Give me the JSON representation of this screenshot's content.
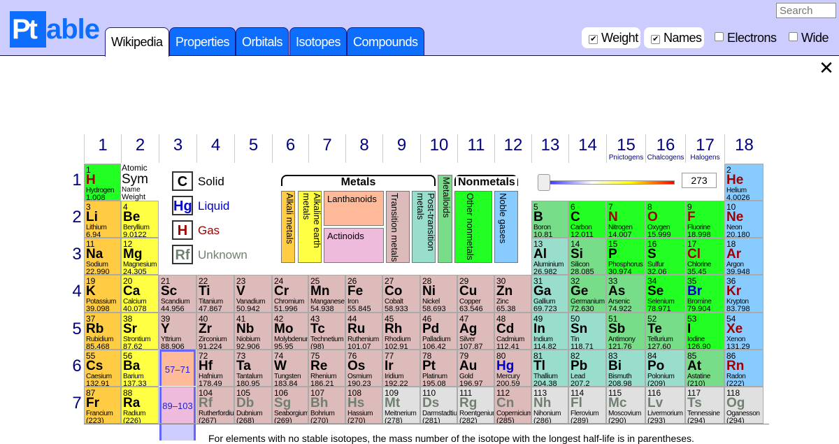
{
  "app": {
    "logo_pt": "Pt",
    "logo_able": "able",
    "search_placeholder": "Search",
    "close_glyph": "✕"
  },
  "tabs": [
    {
      "label": "Wikipedia",
      "active": true
    },
    {
      "label": "Properties",
      "active": false
    },
    {
      "label": "Orbitals",
      "active": false
    },
    {
      "label": "Isotopes",
      "active": false
    },
    {
      "label": "Compounds",
      "active": false
    }
  ],
  "options": [
    {
      "label": "Weight",
      "checked": true
    },
    {
      "label": "Names",
      "checked": true
    },
    {
      "label": "Electrons",
      "checked": false
    },
    {
      "label": "Wide",
      "checked": false
    }
  ],
  "groups": [
    "1",
    "2",
    "3",
    "4",
    "5",
    "6",
    "7",
    "8",
    "9",
    "10",
    "11",
    "12",
    "13",
    "14",
    "15",
    "16",
    "17",
    "18"
  ],
  "group_subtitles": {
    "15": "Pnictogens",
    "16": "Chalcogens",
    "17": "Halogens"
  },
  "periods": [
    "1",
    "2",
    "3",
    "4",
    "5",
    "6",
    "7"
  ],
  "key": {
    "number": "1",
    "sym": "Sym",
    "line1": "Atomic",
    "line3": "Name",
    "line4": "Weight"
  },
  "states": [
    {
      "sym": "C",
      "label": "Solid",
      "color": "#000000"
    },
    {
      "sym": "Hg",
      "label": "Liquid",
      "color": "#0000cc"
    },
    {
      "sym": "H",
      "label": "Gas",
      "color": "#a00000"
    },
    {
      "sym": "Rf",
      "label": "Unknown",
      "color": "#708070"
    }
  ],
  "categories_labels": {
    "metals": "Metals",
    "nonmetals": "Nonmetals"
  },
  "categories": [
    {
      "id": "alkali",
      "label": "Alkali metals",
      "color": "#ffcc44"
    },
    {
      "id": "alkaline",
      "label": "Alkaline earth metals",
      "color": "#ffff44"
    },
    {
      "id": "lanthanoid",
      "label": "Lanthanoids",
      "color": "#ffbb99"
    },
    {
      "id": "actinoid",
      "label": "Actinoids",
      "color": "#eebbdd"
    },
    {
      "id": "transition",
      "label": "Transition metals",
      "color": "#ddbbbb"
    },
    {
      "id": "post",
      "label": "Post-transition metals",
      "color": "#99ddcc"
    },
    {
      "id": "metalloid",
      "label": "Metalloids",
      "color": "#77dd88"
    },
    {
      "id": "nonmetal",
      "label": "Other nonmetals",
      "color": "#22ff22"
    },
    {
      "id": "noble",
      "label": "Noble gases",
      "color": "#88ccff"
    },
    {
      "id": "unknown",
      "label": "Unknown",
      "color": "#e0e0e0"
    }
  ],
  "temperature": "273",
  "series_labels": {
    "lanthanides": "57–71",
    "actinides": "89–103"
  },
  "footnote": "For elements with no stable isotopes, the mass number of the isotope with the longest half-life is in parentheses.",
  "elements": [
    [
      1,
      "H",
      "Hydrogen",
      "1.008",
      1,
      1,
      "nonmetal",
      "gas"
    ],
    [
      2,
      "He",
      "Helium",
      "4.0026",
      18,
      1,
      "noble",
      "gas"
    ],
    [
      3,
      "Li",
      "Lithium",
      "6.94",
      1,
      2,
      "alkali",
      "solid"
    ],
    [
      4,
      "Be",
      "Beryllium",
      "9.0122",
      2,
      2,
      "alkaline",
      "solid"
    ],
    [
      5,
      "B",
      "Boron",
      "10.81",
      13,
      2,
      "metalloid",
      "solid"
    ],
    [
      6,
      "C",
      "Carbon",
      "12.011",
      14,
      2,
      "nonmetal",
      "solid"
    ],
    [
      7,
      "N",
      "Nitrogen",
      "14.007",
      15,
      2,
      "nonmetal",
      "gas"
    ],
    [
      8,
      "O",
      "Oxygen",
      "15.999",
      16,
      2,
      "nonmetal",
      "gas"
    ],
    [
      9,
      "F",
      "Fluorine",
      "18.998",
      17,
      2,
      "nonmetal",
      "gas"
    ],
    [
      10,
      "Ne",
      "Neon",
      "20.180",
      18,
      2,
      "noble",
      "gas"
    ],
    [
      11,
      "Na",
      "Sodium",
      "22.990",
      1,
      3,
      "alkali",
      "solid"
    ],
    [
      12,
      "Mg",
      "Magnesium",
      "24.305",
      2,
      3,
      "alkaline",
      "solid"
    ],
    [
      13,
      "Al",
      "Aluminium",
      "26.982",
      13,
      3,
      "post",
      "solid"
    ],
    [
      14,
      "Si",
      "Silicon",
      "28.085",
      14,
      3,
      "metalloid",
      "solid"
    ],
    [
      15,
      "P",
      "Phosphorus",
      "30.974",
      15,
      3,
      "nonmetal",
      "solid"
    ],
    [
      16,
      "S",
      "Sulfur",
      "32.06",
      16,
      3,
      "nonmetal",
      "solid"
    ],
    [
      17,
      "Cl",
      "Chlorine",
      "35.45",
      17,
      3,
      "nonmetal",
      "gas"
    ],
    [
      18,
      "Ar",
      "Argon",
      "39.948",
      18,
      3,
      "noble",
      "gas"
    ],
    [
      19,
      "K",
      "Potassium",
      "39.098",
      1,
      4,
      "alkali",
      "solid"
    ],
    [
      20,
      "Ca",
      "Calcium",
      "40.078",
      2,
      4,
      "alkaline",
      "solid"
    ],
    [
      21,
      "Sc",
      "Scandium",
      "44.956",
      3,
      4,
      "transition",
      "solid"
    ],
    [
      22,
      "Ti",
      "Titanium",
      "47.867",
      4,
      4,
      "transition",
      "solid"
    ],
    [
      23,
      "V",
      "Vanadium",
      "50.942",
      5,
      4,
      "transition",
      "solid"
    ],
    [
      24,
      "Cr",
      "Chromium",
      "51.996",
      6,
      4,
      "transition",
      "solid"
    ],
    [
      25,
      "Mn",
      "Manganese",
      "54.938",
      7,
      4,
      "transition",
      "solid"
    ],
    [
      26,
      "Fe",
      "Iron",
      "55.845",
      8,
      4,
      "transition",
      "solid"
    ],
    [
      27,
      "Co",
      "Cobalt",
      "58.933",
      9,
      4,
      "transition",
      "solid"
    ],
    [
      28,
      "Ni",
      "Nickel",
      "58.693",
      10,
      4,
      "transition",
      "solid"
    ],
    [
      29,
      "Cu",
      "Copper",
      "63.546",
      11,
      4,
      "transition",
      "solid"
    ],
    [
      30,
      "Zn",
      "Zinc",
      "65.38",
      12,
      4,
      "transition",
      "solid"
    ],
    [
      31,
      "Ga",
      "Gallium",
      "69.723",
      13,
      4,
      "post",
      "solid"
    ],
    [
      32,
      "Ge",
      "Germanium",
      "72.630",
      14,
      4,
      "metalloid",
      "solid"
    ],
    [
      33,
      "As",
      "Arsenic",
      "74.922",
      15,
      4,
      "metalloid",
      "solid"
    ],
    [
      34,
      "Se",
      "Selenium",
      "78.971",
      16,
      4,
      "nonmetal",
      "solid"
    ],
    [
      35,
      "Br",
      "Bromine",
      "79.904",
      17,
      4,
      "nonmetal",
      "liquid"
    ],
    [
      36,
      "Kr",
      "Krypton",
      "83.798",
      18,
      4,
      "noble",
      "gas"
    ],
    [
      37,
      "Rb",
      "Rubidium",
      "85.468",
      1,
      5,
      "alkali",
      "solid"
    ],
    [
      38,
      "Sr",
      "Strontium",
      "87.62",
      2,
      5,
      "alkaline",
      "solid"
    ],
    [
      39,
      "Y",
      "Yttrium",
      "88.906",
      3,
      5,
      "transition",
      "solid"
    ],
    [
      40,
      "Zr",
      "Zirconium",
      "91.224",
      4,
      5,
      "transition",
      "solid"
    ],
    [
      41,
      "Nb",
      "Niobium",
      "92.906",
      5,
      5,
      "transition",
      "solid"
    ],
    [
      42,
      "Mo",
      "Molybdenum",
      "95.95",
      6,
      5,
      "transition",
      "solid"
    ],
    [
      43,
      "Tc",
      "Technetium",
      "(98)",
      7,
      5,
      "transition",
      "solid"
    ],
    [
      44,
      "Ru",
      "Ruthenium",
      "101.07",
      8,
      5,
      "transition",
      "solid"
    ],
    [
      45,
      "Rh",
      "Rhodium",
      "102.91",
      9,
      5,
      "transition",
      "solid"
    ],
    [
      46,
      "Pd",
      "Palladium",
      "106.42",
      10,
      5,
      "transition",
      "solid"
    ],
    [
      47,
      "Ag",
      "Silver",
      "107.87",
      11,
      5,
      "transition",
      "solid"
    ],
    [
      48,
      "Cd",
      "Cadmium",
      "112.41",
      12,
      5,
      "transition",
      "solid"
    ],
    [
      49,
      "In",
      "Indium",
      "114.82",
      13,
      5,
      "post",
      "solid"
    ],
    [
      50,
      "Sn",
      "Tin",
      "118.71",
      14,
      5,
      "post",
      "solid"
    ],
    [
      51,
      "Sb",
      "Antimony",
      "121.76",
      15,
      5,
      "metalloid",
      "solid"
    ],
    [
      52,
      "Te",
      "Tellurium",
      "127.60",
      16,
      5,
      "metalloid",
      "solid"
    ],
    [
      53,
      "I",
      "Iodine",
      "126.90",
      17,
      5,
      "nonmetal",
      "solid"
    ],
    [
      54,
      "Xe",
      "Xenon",
      "131.29",
      18,
      5,
      "noble",
      "gas"
    ],
    [
      55,
      "Cs",
      "Caesium",
      "132.91",
      1,
      6,
      "alkali",
      "solid"
    ],
    [
      56,
      "Ba",
      "Barium",
      "137.33",
      2,
      6,
      "alkaline",
      "solid"
    ],
    [
      72,
      "Hf",
      "Hafnium",
      "178.49",
      4,
      6,
      "transition",
      "solid"
    ],
    [
      73,
      "Ta",
      "Tantalum",
      "180.95",
      5,
      6,
      "transition",
      "solid"
    ],
    [
      74,
      "W",
      "Tungsten",
      "183.84",
      6,
      6,
      "transition",
      "solid"
    ],
    [
      75,
      "Re",
      "Rhenium",
      "186.21",
      7,
      6,
      "transition",
      "solid"
    ],
    [
      76,
      "Os",
      "Osmium",
      "190.23",
      8,
      6,
      "transition",
      "solid"
    ],
    [
      77,
      "Ir",
      "Iridium",
      "192.22",
      9,
      6,
      "transition",
      "solid"
    ],
    [
      78,
      "Pt",
      "Platinum",
      "195.08",
      10,
      6,
      "transition",
      "solid"
    ],
    [
      79,
      "Au",
      "Gold",
      "196.97",
      11,
      6,
      "transition",
      "solid"
    ],
    [
      80,
      "Hg",
      "Mercury",
      "200.59",
      12,
      6,
      "transition",
      "liquid"
    ],
    [
      81,
      "Tl",
      "Thallium",
      "204.38",
      13,
      6,
      "post",
      "solid"
    ],
    [
      82,
      "Pb",
      "Lead",
      "207.2",
      14,
      6,
      "post",
      "solid"
    ],
    [
      83,
      "Bi",
      "Bismuth",
      "208.98",
      15,
      6,
      "post",
      "solid"
    ],
    [
      84,
      "Po",
      "Polonium",
      "(209)",
      16,
      6,
      "post",
      "solid"
    ],
    [
      85,
      "At",
      "Astatine",
      "(210)",
      17,
      6,
      "metalloid",
      "solid"
    ],
    [
      86,
      "Rn",
      "Radon",
      "(222)",
      18,
      6,
      "noble",
      "gas"
    ],
    [
      87,
      "Fr",
      "Francium",
      "(223)",
      1,
      7,
      "alkali",
      "solid"
    ],
    [
      88,
      "Ra",
      "Radium",
      "(226)",
      2,
      7,
      "alkaline",
      "solid"
    ],
    [
      104,
      "Rf",
      "Rutherfordium",
      "(267)",
      4,
      7,
      "transition",
      "unknown"
    ],
    [
      105,
      "Db",
      "Dubnium",
      "(268)",
      5,
      7,
      "transition",
      "unknown"
    ],
    [
      106,
      "Sg",
      "Seaborgium",
      "(269)",
      6,
      7,
      "transition",
      "unknown"
    ],
    [
      107,
      "Bh",
      "Bohrium",
      "(270)",
      7,
      7,
      "transition",
      "unknown"
    ],
    [
      108,
      "Hs",
      "Hassium",
      "(270)",
      8,
      7,
      "transition",
      "unknown"
    ],
    [
      109,
      "Mt",
      "Meitnerium",
      "(278)",
      9,
      7,
      "unknown",
      "unknown"
    ],
    [
      110,
      "Ds",
      "Darmstadtium",
      "(281)",
      10,
      7,
      "unknown",
      "unknown"
    ],
    [
      111,
      "Rg",
      "Roentgenium",
      "(282)",
      11,
      7,
      "unknown",
      "unknown"
    ],
    [
      112,
      "Cn",
      "Copernicium",
      "(285)",
      12,
      7,
      "transition",
      "unknown"
    ],
    [
      113,
      "Nh",
      "Nihonium",
      "(286)",
      13,
      7,
      "unknown",
      "unknown"
    ],
    [
      114,
      "Fl",
      "Flerovium",
      "(289)",
      14,
      7,
      "unknown",
      "unknown"
    ],
    [
      115,
      "Mc",
      "Moscovium",
      "(290)",
      15,
      7,
      "unknown",
      "unknown"
    ],
    [
      116,
      "Lv",
      "Livermorium",
      "(293)",
      16,
      7,
      "unknown",
      "unknown"
    ],
    [
      117,
      "Ts",
      "Tennessine",
      "(294)",
      17,
      7,
      "unknown",
      "unknown"
    ],
    [
      118,
      "Og",
      "Oganesson",
      "(294)",
      18,
      7,
      "unknown",
      "unknown"
    ]
  ]
}
